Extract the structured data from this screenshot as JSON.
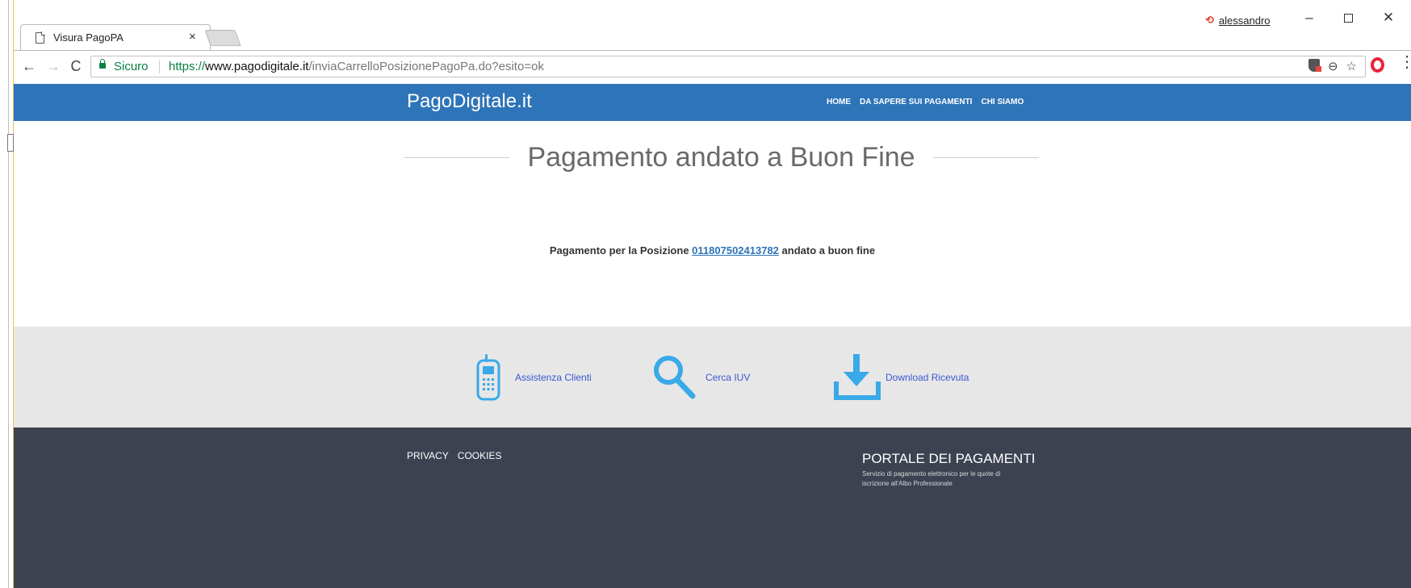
{
  "browser": {
    "tab_title": "Visura PagoPA",
    "tab_close": "×",
    "profile_name": "alessandro",
    "window_minimize": "–",
    "window_close": "✕",
    "secure_label": "Sicuro",
    "url_scheme": "https://",
    "url_host": "www.pagodigitale.it",
    "url_path": "/inviaCarrelloPosizionePagoPa.do?esito=ok",
    "nav_back": "←",
    "nav_forward": "→",
    "nav_reload": "C",
    "menu_dots": "⋮"
  },
  "header": {
    "brand": "PagoDigitale.it",
    "nav": [
      "HOME",
      "DA SAPERE SUI PAGAMENTI",
      "CHI SIAMO"
    ]
  },
  "main": {
    "title": "Pagamento andato a Buon Fine",
    "message_prefix": "Pagamento per la Posizione",
    "position_code": "011807502413782",
    "message_suffix": "andato a buon fine"
  },
  "footer_links": {
    "assistenza": "Assistenza Clienti",
    "cerca": "Cerca IUV",
    "download": "Download Ricevuta",
    "icon_color": "#39a9e8"
  },
  "footer": {
    "legal": [
      "PRIVACY",
      "COOKIES"
    ],
    "portal_title": "PORTALE DEI PAGAMENTI",
    "portal_desc": "Servizio di pagamento elettronico per le quote di iscrizione all'Albo Professionale"
  },
  "colors": {
    "header_bg": "#2e74b8",
    "band_bg": "#e7e7e7",
    "footer_bg": "#3c4250",
    "secure_green": "#0b8043"
  }
}
